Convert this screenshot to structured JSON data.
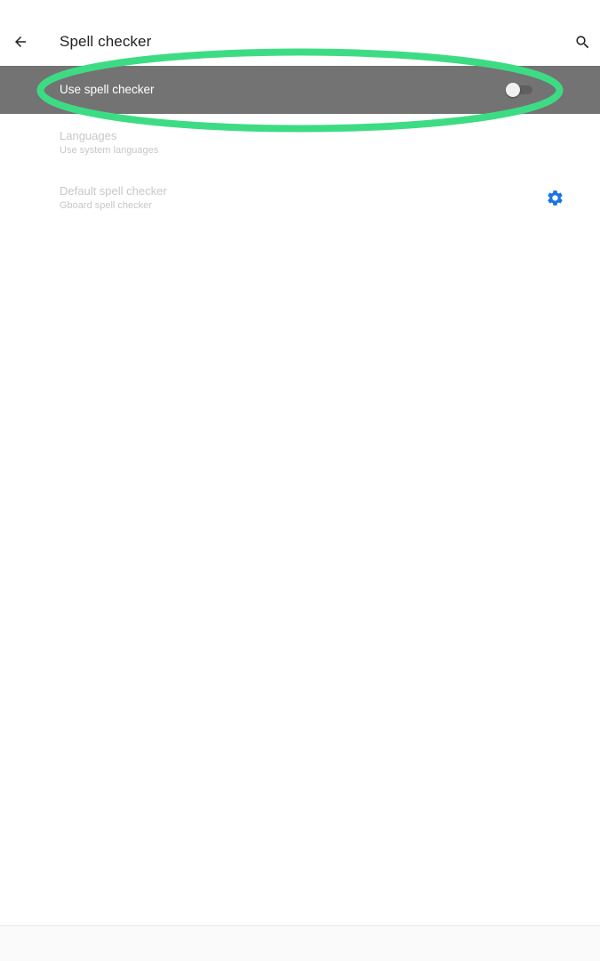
{
  "app_bar": {
    "title": "Spell checker",
    "back_icon": "arrow-back-icon",
    "search_icon": "search-icon"
  },
  "spell_checker_toggle": {
    "label": "Use spell checker",
    "state": "off",
    "highlight_color": "#737373",
    "annotation_color": "#3ddc84"
  },
  "languages": {
    "title": "Languages",
    "subtitle": "Use system languages",
    "enabled": false
  },
  "default_spell_checker": {
    "title": "Default spell checker",
    "subtitle": "Gboard spell checker",
    "settings_icon": "gear-icon",
    "accent_color": "#1a73e8",
    "enabled": false
  }
}
